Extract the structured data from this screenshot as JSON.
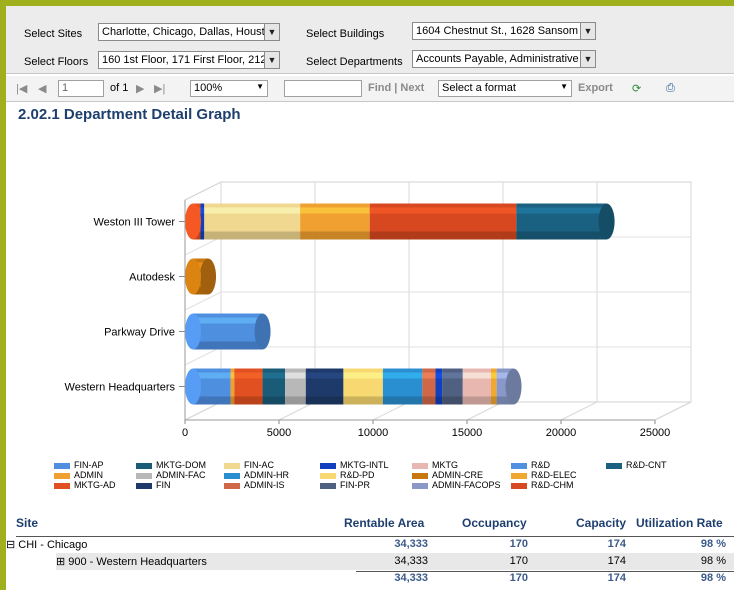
{
  "params": {
    "sites_label": "Select Sites",
    "sites_value": "Charlotte, Chicago, Dallas, Housto",
    "buildings_label": "Select Buildings",
    "buildings_value": "1604 Chestnut St., 1628 Sansom",
    "floors_label": "Select Floors",
    "floors_value": "160 1st Floor, 171 First Floor, 212",
    "departments_label": "Select Departments",
    "departments_value": "Accounts Payable, Administrative"
  },
  "toolbar": {
    "page_input": "1",
    "page_of": "of 1",
    "zoom": "100%",
    "find_next": "Find | Next",
    "format_select": "Select a format",
    "export": "Export"
  },
  "report_title": "2.02.1 Department Detail Graph",
  "legend": [
    {
      "label": "FIN-AP",
      "color": "#4f8fe0"
    },
    {
      "label": "ADMIN",
      "color": "#f0a030"
    },
    {
      "label": "MKTG-AD",
      "color": "#e05020"
    },
    {
      "label": "MKTG-DOM",
      "color": "#1a5c78"
    },
    {
      "label": "ADMIN-FAC",
      "color": "#b8b8b8"
    },
    {
      "label": "FIN",
      "color": "#1e3a6a"
    },
    {
      "label": "FIN-AC",
      "color": "#f0d890"
    },
    {
      "label": "ADMIN-HR",
      "color": "#2a8fd0"
    },
    {
      "label": "ADMIN-IS",
      "color": "#d06848"
    },
    {
      "label": "MKTG-INTL",
      "color": "#1040c0"
    },
    {
      "label": "R&D-PD",
      "color": "#f8d870"
    },
    {
      "label": "FIN-PR",
      "color": "#506080"
    },
    {
      "label": "MKTG",
      "color": "#e8b8b0"
    },
    {
      "label": "ADMIN-CRE",
      "color": "#c87810"
    },
    {
      "label": "ADMIN-FACOPS",
      "color": "#8898c8"
    },
    {
      "label": "R&D",
      "color": "#5090e0"
    },
    {
      "label": "R&D-ELEC",
      "color": "#f0a830"
    },
    {
      "label": "R&D-CHM",
      "color": "#d84820"
    },
    {
      "label": "R&D-CNT",
      "color": "#1a6080"
    }
  ],
  "chart_data": {
    "type": "bar",
    "orientation": "horizontal-stacked-3d",
    "categories": [
      "Weston III Tower",
      "Autodesk",
      "Parkway Drive",
      "Western Headquarters"
    ],
    "xlim": [
      0,
      25000
    ],
    "xticks": [
      "0",
      "5000",
      "10000",
      "15000",
      "20000",
      "25000"
    ],
    "grid": true,
    "legend_position": "bottom",
    "stacks": [
      {
        "category": "Weston III Tower",
        "segments": [
          {
            "name": "MKTG-AD",
            "value": 400
          },
          {
            "name": "MKTG-INTL",
            "value": 200
          },
          {
            "name": "FIN-AC",
            "value": 5100
          },
          {
            "name": "ADMIN",
            "value": 3700
          },
          {
            "name": "R&D-CHM",
            "value": 7800
          },
          {
            "name": "R&D-CNT",
            "value": 4800
          }
        ]
      },
      {
        "category": "Autodesk",
        "segments": [
          {
            "name": "ADMIN-CRE",
            "value": 800
          }
        ]
      },
      {
        "category": "Parkway Drive",
        "segments": [
          {
            "name": "FIN-AP",
            "value": 3700
          }
        ]
      },
      {
        "category": "Western Headquarters",
        "segments": [
          {
            "name": "FIN-AP",
            "value": 2000
          },
          {
            "name": "ADMIN",
            "value": 200
          },
          {
            "name": "MKTG-AD",
            "value": 1500
          },
          {
            "name": "MKTG-DOM",
            "value": 1200
          },
          {
            "name": "ADMIN-FAC",
            "value": 1100
          },
          {
            "name": "FIN",
            "value": 2000
          },
          {
            "name": "R&D-PD",
            "value": 2100
          },
          {
            "name": "ADMIN-HR",
            "value": 2100
          },
          {
            "name": "ADMIN-IS",
            "value": 700
          },
          {
            "name": "MKTG-INTL",
            "value": 350
          },
          {
            "name": "FIN-PR",
            "value": 1100
          },
          {
            "name": "MKTG",
            "value": 1500
          },
          {
            "name": "R&D-ELEC",
            "value": 300
          },
          {
            "name": "ADMIN-FACOPS",
            "value": 900
          }
        ]
      }
    ]
  },
  "table": {
    "headers": {
      "site": "Site",
      "area": "Rentable Area",
      "occ": "Occupancy",
      "cap": "Capacity",
      "util": "Utilization Rate"
    },
    "group": {
      "label": "⊟ CHI - Chicago",
      "area": "34,333",
      "occ": "170",
      "cap": "174",
      "util": "98 %"
    },
    "row": {
      "label": "⊞ 900 - Western Headquarters",
      "area": "34,333",
      "occ": "170",
      "cap": "174",
      "util": "98 %"
    },
    "total": {
      "area": "34,333",
      "occ": "170",
      "cap": "174",
      "util": "98 %"
    }
  }
}
